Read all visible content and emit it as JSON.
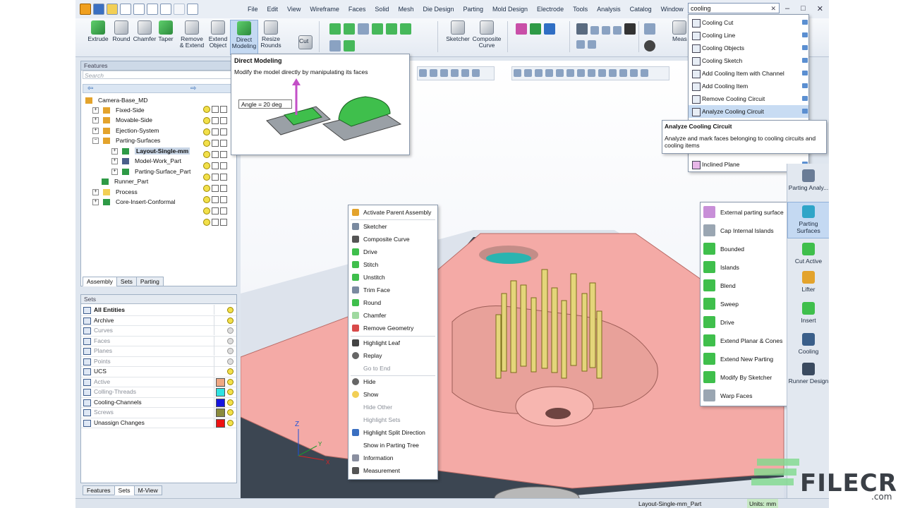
{
  "menu": [
    "File",
    "Edit",
    "View",
    "Wireframe",
    "Faces",
    "Solid",
    "Mesh",
    "Die Design",
    "Parting",
    "Mold Design",
    "Electrode",
    "Tools",
    "Analysis",
    "Catalog",
    "Window"
  ],
  "search": {
    "value": "cooling",
    "clear": "✕"
  },
  "window_controls": {
    "minimize": "–",
    "restore": "□",
    "close": "✕"
  },
  "ribbon": {
    "buttons": [
      "Extrude",
      "Round",
      "Chamfer",
      "Taper",
      "Remove & Extend",
      "Extend Object",
      "Direct Modeling",
      "Resize Rounds",
      "Cut",
      "Sketcher",
      "Composite Curve",
      "Meas"
    ]
  },
  "tooltip_direct": {
    "title": "Direct Modeling",
    "body": "Modify the model directly by manipulating its faces",
    "angle": "Angle = 20 deg"
  },
  "tooltip_cooling": {
    "title": "Analyze Cooling Circuit",
    "body": "Analyze and mark faces belonging to cooling circuits and cooling items"
  },
  "features_panel": {
    "title": "Features",
    "search_placeholder": "Search",
    "tree": [
      {
        "label": "Camera-Base_MD",
        "level": 0
      },
      {
        "label": "Fixed-Side",
        "level": 1
      },
      {
        "label": "Movable-Side",
        "level": 1
      },
      {
        "label": "Ejection-System",
        "level": 1
      },
      {
        "label": "Parting-Surfaces",
        "level": 1
      },
      {
        "label": "Layout-Single-mm",
        "level": 2
      },
      {
        "label": "Model-Work_Part",
        "level": 2
      },
      {
        "label": "Parting-Surface_Part",
        "level": 2
      },
      {
        "label": "Runner_Part",
        "level": 1
      },
      {
        "label": "Process",
        "level": 1
      },
      {
        "label": "Core-Insert-Conformal",
        "level": 1
      }
    ],
    "tabs": [
      "Assembly",
      "Sets",
      "Parting"
    ]
  },
  "sets_panel": {
    "header": "Sets",
    "rows": [
      {
        "label": "All Entities",
        "color": ""
      },
      {
        "label": "Archive",
        "color": ""
      },
      {
        "label": "Curves",
        "color": ""
      },
      {
        "label": "Faces",
        "color": ""
      },
      {
        "label": "Planes",
        "color": ""
      },
      {
        "label": "Points",
        "color": ""
      },
      {
        "label": "UCS",
        "color": ""
      },
      {
        "label": "Active",
        "color": "#f0a883"
      },
      {
        "label": "Colling-Threads",
        "color": "#2fe3e3"
      },
      {
        "label": "Cooling-Channels",
        "color": "#1414e0"
      },
      {
        "label": "Screws",
        "color": "#8a8a3c"
      },
      {
        "label": "Unassign Changes",
        "color": "#ee1111"
      }
    ],
    "tabs": [
      "Features",
      "Sets",
      "M-View"
    ]
  },
  "context_menu": [
    "Activate Parent Assembly",
    "Sketcher",
    "Composite Curve",
    "Drive",
    "Stitch",
    "Unstitch",
    "Trim Face",
    "Round",
    "Chamfer",
    "Remove Geometry",
    "Highlight Leaf",
    "Replay",
    "Go to End",
    "Hide",
    "Show",
    "Hide Other",
    "Highlight Sets",
    "Highlight Split Direction",
    "Show in Parting Tree",
    "Information",
    "Measurement"
  ],
  "search_results": [
    "Cooling Cut",
    "Cooling Line",
    "Cooling Objects",
    "Cooling Sketch",
    "Add Cooling Item with Channel",
    "Add Cooling Item",
    "Remove Cooling Circuit",
    "Analyze Cooling Circuit",
    "Inclined Plane"
  ],
  "parting_surfaces_menu": [
    "External parting surface",
    "Cap Internal Islands",
    "Bounded",
    "Islands",
    "Blend",
    "Sweep",
    "Drive",
    "Extend Planar & Cones",
    "Extend New Parting",
    "Modify By Sketcher",
    "Warp Faces"
  ],
  "right_bar": [
    "Parting Analy...",
    "Parting Surfaces",
    "Cut Active",
    "Lifter",
    "Insert",
    "Cooling",
    "Runner Design"
  ],
  "status": {
    "part": "Layout-Single-mm_Part",
    "units": "Units: mm"
  },
  "axes": {
    "x": "X",
    "y": "Y",
    "z": "Z"
  },
  "watermark": {
    "brand": "FILECR",
    "domain": ".com"
  }
}
